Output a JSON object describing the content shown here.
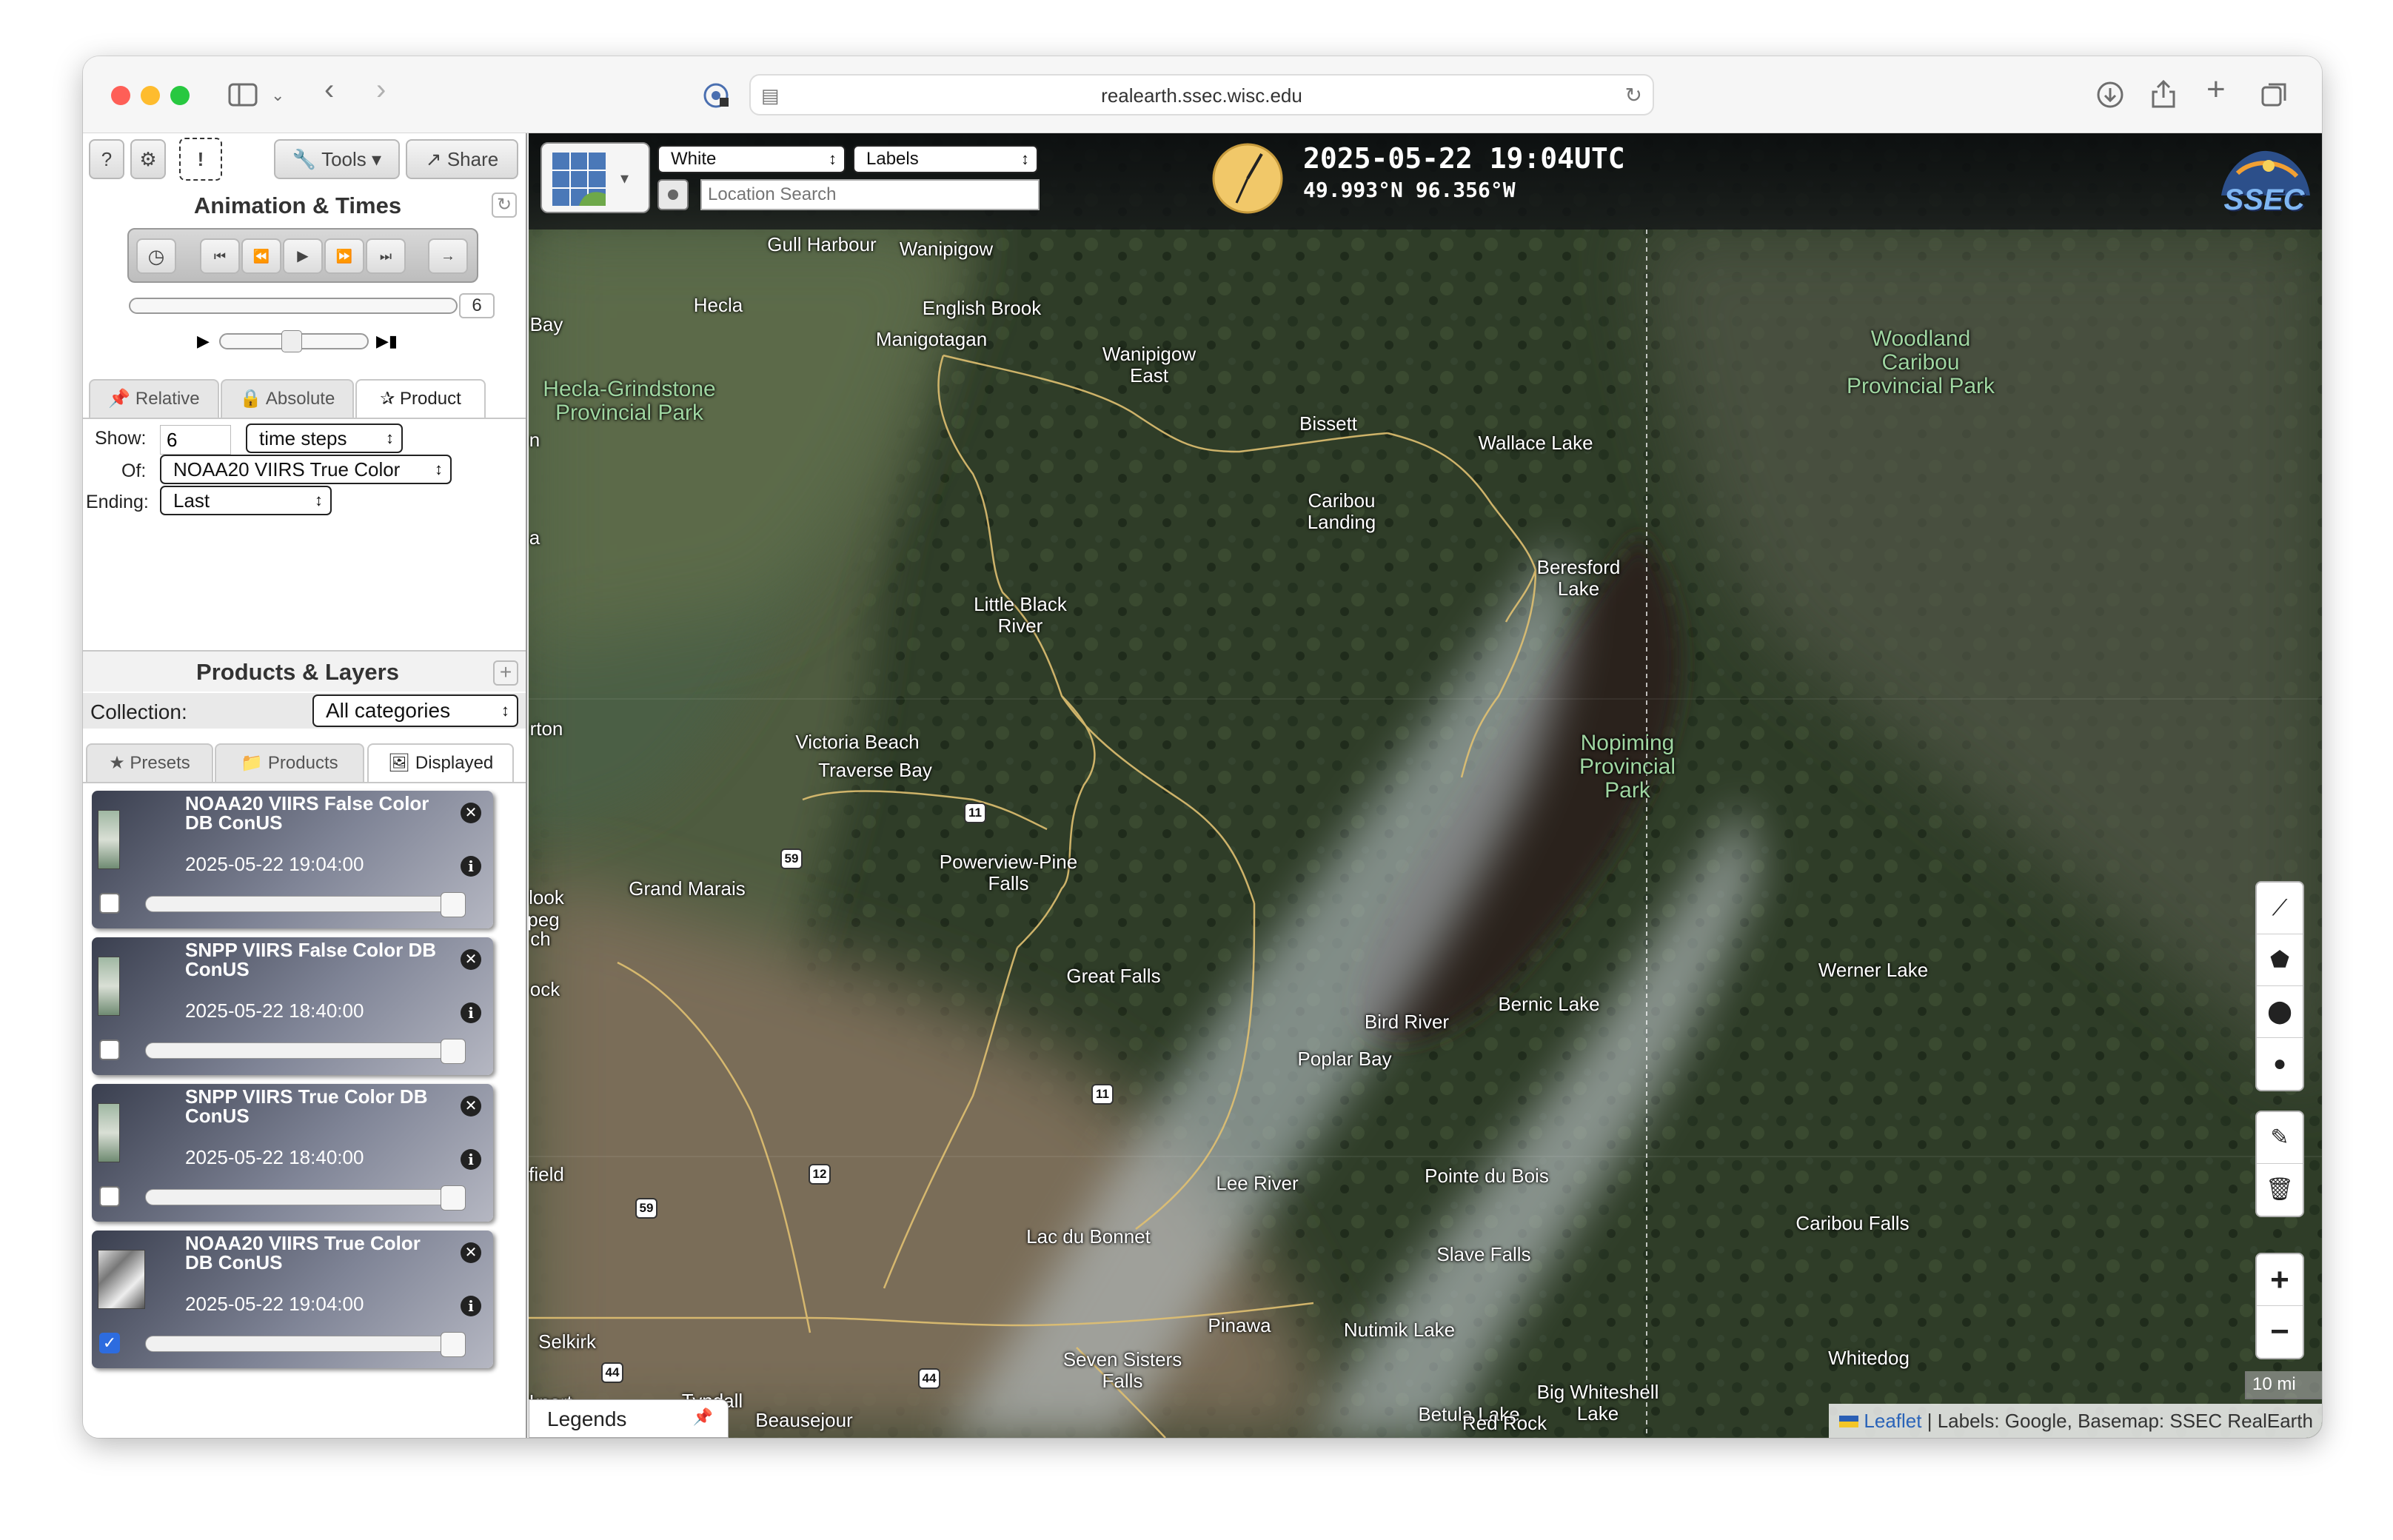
{
  "browser": {
    "url": "realearth.ssec.wisc.edu"
  },
  "toolbar": {
    "help_label": "?",
    "alert_label": "!",
    "tools_label": "Tools",
    "share_label": "Share"
  },
  "animation": {
    "title": "Animation & Times",
    "frame_count": "6",
    "tabs": [
      "Relative",
      "Absolute",
      "Product"
    ],
    "active_tab": "Product",
    "show_label": "Show:",
    "show_value": "6",
    "step_unit": "time steps",
    "of_label": "Of:",
    "of_value": "NOAA20 VIIRS True Color",
    "ending_label": "Ending:",
    "ending_value": "Last"
  },
  "products": {
    "title": "Products & Layers",
    "collection_label": "Collection:",
    "collection_value": "All categories",
    "tabs": [
      "Presets",
      "Products",
      "Displayed"
    ],
    "active_tab": "Displayed",
    "layers": [
      {
        "name": "NOAA20 VIIRS False Color DB ConUS",
        "time": "2025-05-22 19:04:00",
        "checked": false
      },
      {
        "name": "SNPP VIIRS False Color DB ConUS",
        "time": "2025-05-22 18:40:00",
        "checked": false
      },
      {
        "name": "SNPP VIIRS True Color DB ConUS",
        "time": "2025-05-22 18:40:00",
        "checked": false
      },
      {
        "name": "NOAA20 VIIRS True Color DB ConUS",
        "time": "2025-05-22 19:04:00",
        "checked": true
      }
    ]
  },
  "map": {
    "basemap_select": "White",
    "labels_select": "Labels",
    "search_placeholder": "Location Search",
    "datetime": "2025-05-22 19:04UTC",
    "coords": "49.993°N 96.356°W",
    "logo": "SSEC",
    "scale": "10 mi",
    "legends_label": "Legends",
    "attribution_link": "Leaflet",
    "attribution_text": "| Labels: Google, Basemap: SSEC RealEarth",
    "zoom_in": "+",
    "zoom_out": "−",
    "places": [
      {
        "name": "Gull Harbour"
      },
      {
        "name": "Wanipigow"
      },
      {
        "name": "Hecla"
      },
      {
        "name": "English Brook"
      },
      {
        "name": "Manigotagan"
      },
      {
        "name": "Wanipigow East"
      },
      {
        "name": "Bay"
      },
      {
        "name": "Hecla-Grindstone Provincial Park"
      },
      {
        "name": "Bissett"
      },
      {
        "name": "Wallace Lake"
      },
      {
        "name": "Woodland Caribou Provincial Park"
      },
      {
        "name": "Caribou Landing"
      },
      {
        "name": "Beresford Lake"
      },
      {
        "name": "Little Black River"
      },
      {
        "name": "Victoria Beach"
      },
      {
        "name": "Traverse Bay"
      },
      {
        "name": "Nopiming Provincial Park"
      },
      {
        "name": "rton"
      },
      {
        "name": "Powerview-Pine Falls"
      },
      {
        "name": "Grand Marais"
      },
      {
        "name": "look"
      },
      {
        "name": "peg"
      },
      {
        "name": "ch"
      },
      {
        "name": "ock"
      },
      {
        "name": "Great Falls"
      },
      {
        "name": "Werner Lake"
      },
      {
        "name": "Bernic Lake"
      },
      {
        "name": "Bird River"
      },
      {
        "name": "Poplar Bay"
      },
      {
        "name": "field"
      },
      {
        "name": "Pointe du Bois"
      },
      {
        "name": "Lee River"
      },
      {
        "name": "Caribou Falls"
      },
      {
        "name": "Lac du Bonnet"
      },
      {
        "name": "Slave Falls"
      },
      {
        "name": "Selkirk"
      },
      {
        "name": "Pinawa"
      },
      {
        "name": "Nutimik Lake"
      },
      {
        "name": "Seven Sisters Falls"
      },
      {
        "name": "Whitedog"
      },
      {
        "name": "Big Whiteshell Lake"
      },
      {
        "name": "kport"
      },
      {
        "name": "Tyndall"
      },
      {
        "name": "Beausejour"
      },
      {
        "name": "Betula Lake"
      },
      {
        "name": "Red Rock"
      },
      {
        "name": "a"
      },
      {
        "name": "n"
      }
    ],
    "highways": [
      "11",
      "59",
      "11",
      "12",
      "59",
      "44",
      "44"
    ]
  }
}
